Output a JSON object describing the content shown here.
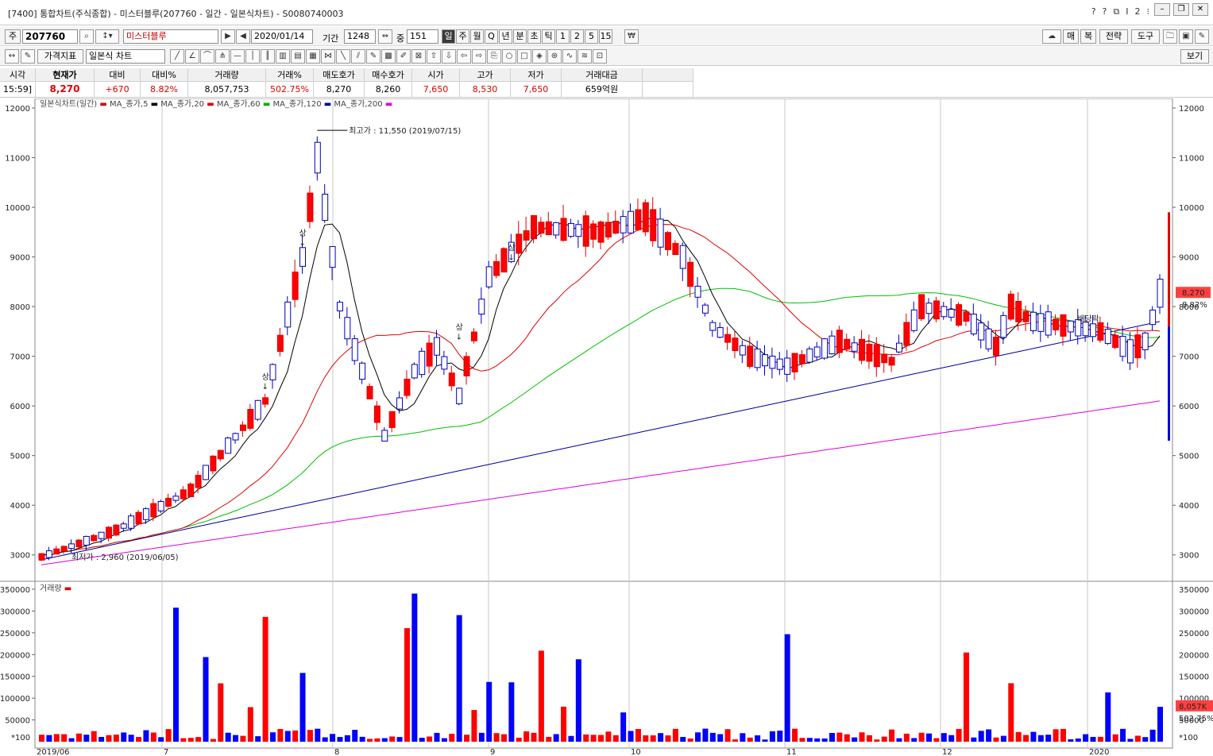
{
  "window": {
    "title": "[7400] 통합차트(주식종합) - 미스터블루(207760 - 일간 - 일본식차트) - S0080740003",
    "right_icons": [
      "?",
      "?",
      "⧉",
      "Ⅰ",
      "2",
      "⁝"
    ]
  },
  "toolbar": {
    "code_prefix": "주",
    "code": "207760",
    "stock_name": "미스터블루",
    "date": "2020/01/14",
    "period_label": "기간",
    "period_value": "1248",
    "count_label": "중",
    "count_value": "151",
    "periods": [
      "일",
      "주",
      "월",
      "Q",
      "년",
      "분",
      "초",
      "틱",
      "1",
      "2",
      "5",
      "15"
    ],
    "selected_period": "일",
    "right_buttons": [
      "매",
      "복",
      "전략",
      "도구"
    ],
    "indicator_button": "가격지표",
    "chart_type": "일본식 차트",
    "view_button": "보기"
  },
  "quote": {
    "headers": [
      "시각",
      "현재가",
      "대비",
      "대비%",
      "거래량",
      "거래%",
      "매도호가",
      "매수호가",
      "시가",
      "고가",
      "저가",
      "거래대금"
    ],
    "values": [
      "15:59]",
      "8,270",
      "+670",
      "8.82%",
      "8,057,753",
      "502.75%",
      "8,270",
      "8,260",
      "7,650",
      "8,530",
      "7,650",
      "659억원"
    ]
  },
  "chart_data": [
    {
      "type": "candlestick",
      "legend": "일본식차트(일간) ▪ MA_종가,5 ▪ MA_종가,20 ▪ MA_종가,60 ▪ MA_종가,120 ▪ MA_종가,200",
      "series_names": [
        "일본식차트(일간)",
        "MA_종가,5",
        "MA_종가,20",
        "MA_종가,60",
        "MA_종가,120",
        "MA_종가,200"
      ],
      "ma_colors": {
        "MA_종가,5": "#000000",
        "MA_종가,20": "#e00000",
        "MA_종가,60": "#00c000",
        "MA_종가,120": "#0000a0",
        "MA_종가,200": "#e000e0"
      },
      "y_ticks": [
        3000,
        4000,
        5000,
        6000,
        7000,
        8000,
        9000,
        10000,
        11000,
        12000
      ],
      "ylim": [
        2500,
        12000
      ],
      "x_labels": [
        "2019/06",
        "7",
        "8",
        "9",
        "10",
        "11",
        "12",
        "2020"
      ],
      "annotations": {
        "high": "최고가 : 11,550 (2019/07/15)",
        "low": "최저가 : 2,960 (2019/06/05)",
        "limit_up": "상",
        "ex_dividend": "배당락"
      },
      "current_price": "8,270",
      "current_change": "8.82%"
    },
    {
      "type": "bar",
      "title": "거래량",
      "y_ticks": [
        50000,
        100000,
        150000,
        200000,
        250000,
        300000,
        350000
      ],
      "ylim": [
        0,
        350000
      ],
      "scale_label": "*100",
      "last_volume": "8,057K",
      "last_volume_pct": "502.75%"
    }
  ]
}
